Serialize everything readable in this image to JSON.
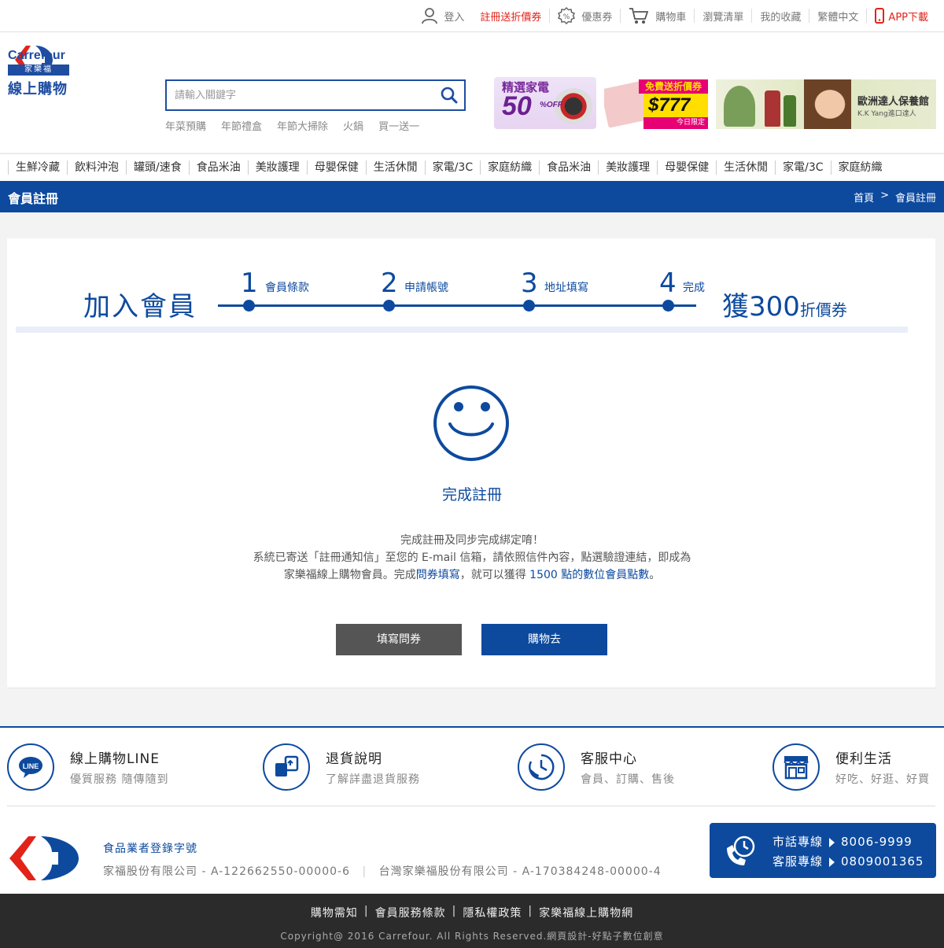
{
  "topbar": {
    "login": "登入",
    "register_promo": "註冊送折價券",
    "coupons": "優惠券",
    "cart": "購物車",
    "browse_list": "瀏覽清單",
    "favorites": "我的收藏",
    "language": "繁體中文",
    "app_download": "APP下載"
  },
  "header": {
    "logo_brand": "Carrefour",
    "logo_cjk": "家樂福",
    "logo_sub": "線上購物",
    "search_placeholder": "請輸入關鍵字",
    "hot_keywords": [
      "年菜預購",
      "年節禮盒",
      "年節大掃除",
      "火鍋",
      "買一送一"
    ],
    "banner1": {
      "line1": "精選家電",
      "discount": "50",
      "suffix": "%OFF"
    },
    "banner2": {
      "top": "免費送折價券",
      "amount": "$777",
      "bottom": "今日限定"
    },
    "banner3": {
      "title": "歐洲達人保養館",
      "subtitle": "K.K Yang進口達人"
    }
  },
  "nav": {
    "items": [
      "生鮮冷藏",
      "飲料沖泡",
      "罐頭/速食",
      "食品米油",
      "美妝護理",
      "母嬰保健",
      "生活休閒",
      "家電/3C",
      "家庭紡織",
      "食品米油",
      "美妝護理",
      "母嬰保健",
      "生活休閒",
      "家電/3C",
      "家庭紡織"
    ]
  },
  "page": {
    "title": "會員註冊",
    "breadcrumb": [
      "首頁",
      ">",
      "會員註冊"
    ]
  },
  "steps": {
    "heading": "加入會員",
    "items": [
      {
        "num": "1",
        "label": "會員條款"
      },
      {
        "num": "2",
        "label": "申請帳號"
      },
      {
        "num": "3",
        "label": "地址填寫"
      },
      {
        "num": "4",
        "label": "完成"
      }
    ],
    "reward_prefix": "獲",
    "reward_amount": "300",
    "reward_suffix": "折價券"
  },
  "result": {
    "title": "完成註冊",
    "line1": "完成註冊及同步完成綁定唷！",
    "line2": "系統已寄送「註冊通知信」至您的 E-mail 信箱，請依照信件內容，點選驗證連結，即成為",
    "line3_a": "家樂福線上購物會員。完成",
    "line3_link": "問券填寫",
    "line3_b": "，就可以獲得 ",
    "line3_points": "1500 點的數位會員點數",
    "line3_c": "。",
    "btn_survey": "填寫問券",
    "btn_shop": "購物去"
  },
  "footer": {
    "services": [
      {
        "title": "線上購物LINE",
        "sub": "優質服務 隨傳隨到",
        "icon": "line-icon"
      },
      {
        "title": "退貨說明",
        "sub": "了解詳盡退貨服務",
        "icon": "return-icon"
      },
      {
        "title": "客服中心",
        "sub": "會員、訂購、售後",
        "icon": "service-clock-icon"
      },
      {
        "title": "便利生活",
        "sub": "好吃、好逛、好買",
        "icon": "store-icon"
      }
    ],
    "license_title": "食品業者登錄字號",
    "license_1": "家福股份有限公司 - A-122662550-00000-6",
    "license_2": "台灣家樂福股份有限公司 - A-170384248-00000-4",
    "hotline": [
      {
        "label": "市話專線",
        "number": "8006-9999"
      },
      {
        "label": "客服專線",
        "number": "0809001365"
      }
    ],
    "links": [
      "購物需知",
      "會員服務條款",
      "隱私權政策",
      "家樂福線上購物網"
    ],
    "copyright": "Copyright@ 2016 Carrefour. All Rights Reserved.網頁設計-好點子數位創意"
  },
  "colors": {
    "brand_blue": "#0d4a9e",
    "brand_red": "#e2231a"
  }
}
